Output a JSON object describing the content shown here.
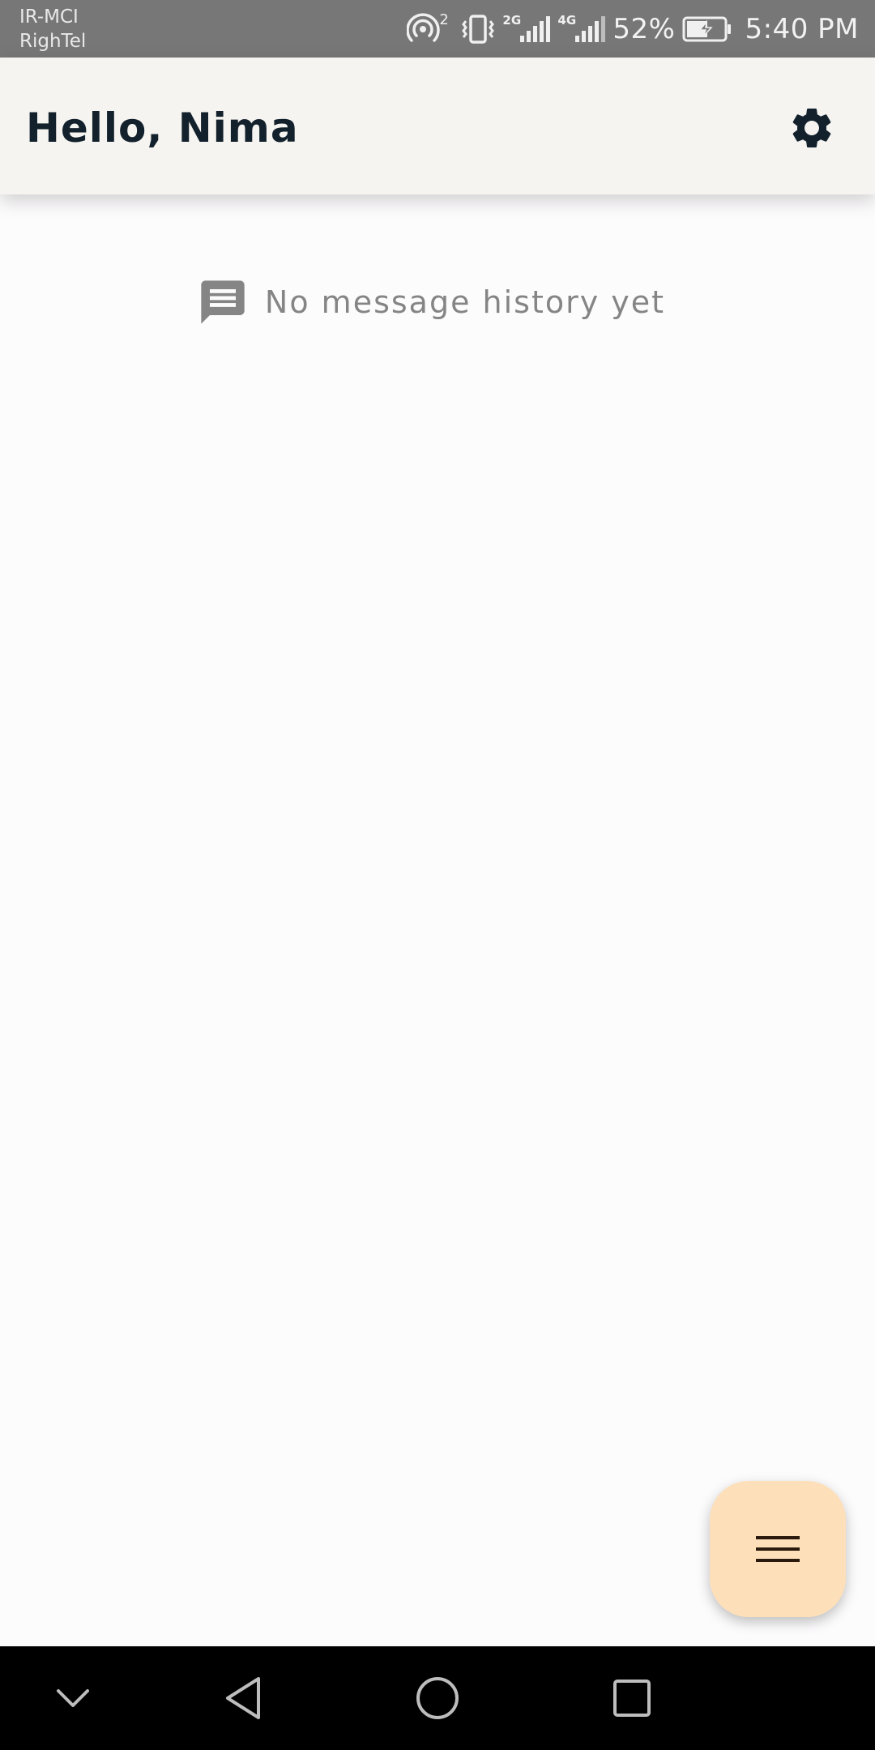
{
  "status_bar": {
    "carrier_1": "IR-MCI",
    "carrier_2": "RighTel",
    "signal_1_label": "2G",
    "signal_2_label": "4G",
    "hotspot_count": "2",
    "battery": "52%",
    "time": "5:40 PM"
  },
  "header": {
    "greeting": "Hello, Nima",
    "settings_icon": "gear-icon"
  },
  "empty_state": {
    "icon": "message-icon",
    "text": "No message history yet"
  },
  "fab": {
    "icon": "menu-icon"
  },
  "nav_bar": {
    "buttons": [
      "chevron-down-icon",
      "back-icon",
      "home-icon",
      "recents-icon"
    ]
  },
  "colors": {
    "status_bar": "#777777",
    "app_bar": "#f5f4f0",
    "greeting_text": "#13212d",
    "background": "#fdfcfd",
    "empty_text": "#858585",
    "fab": "#fde0b9",
    "nav_bar": "#000000"
  }
}
